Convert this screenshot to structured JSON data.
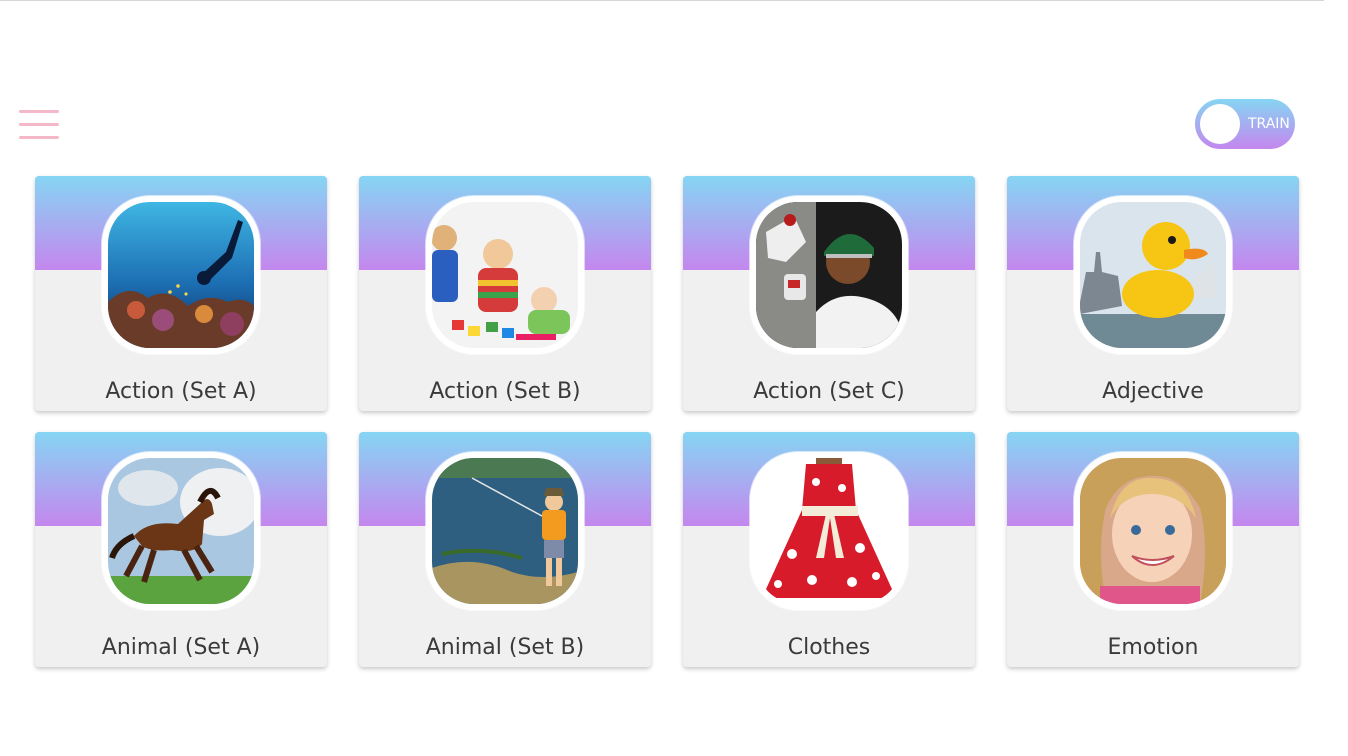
{
  "toolbar": {
    "menu_icon": "hamburger-menu-icon",
    "toggle_label": "TRAIN"
  },
  "colors": {
    "menu": "#f5b8c8",
    "gradient_top": "#86d5f3",
    "gradient_bottom": "#c487ee",
    "card_bg": "#f0f0f0"
  },
  "categories": [
    {
      "label": "Action (Set A)",
      "image": "scuba-diver-over-coral-reef"
    },
    {
      "label": "Action (Set B)",
      "image": "children-playing-with-toys"
    },
    {
      "label": "Action (Set C)",
      "image": "cricket-wicketkeeper-catching-ball"
    },
    {
      "label": "Adjective",
      "image": "giant-yellow-rubber-duck-beside-warship"
    },
    {
      "label": "Animal (Set A)",
      "image": "brown-horse-galloping-on-grass"
    },
    {
      "label": "Animal (Set B)",
      "image": "child-fishing-at-pond"
    },
    {
      "label": "Clothes",
      "image": "red-snowflake-party-dress"
    },
    {
      "label": "Emotion",
      "image": "smiling-blonde-girl"
    }
  ]
}
